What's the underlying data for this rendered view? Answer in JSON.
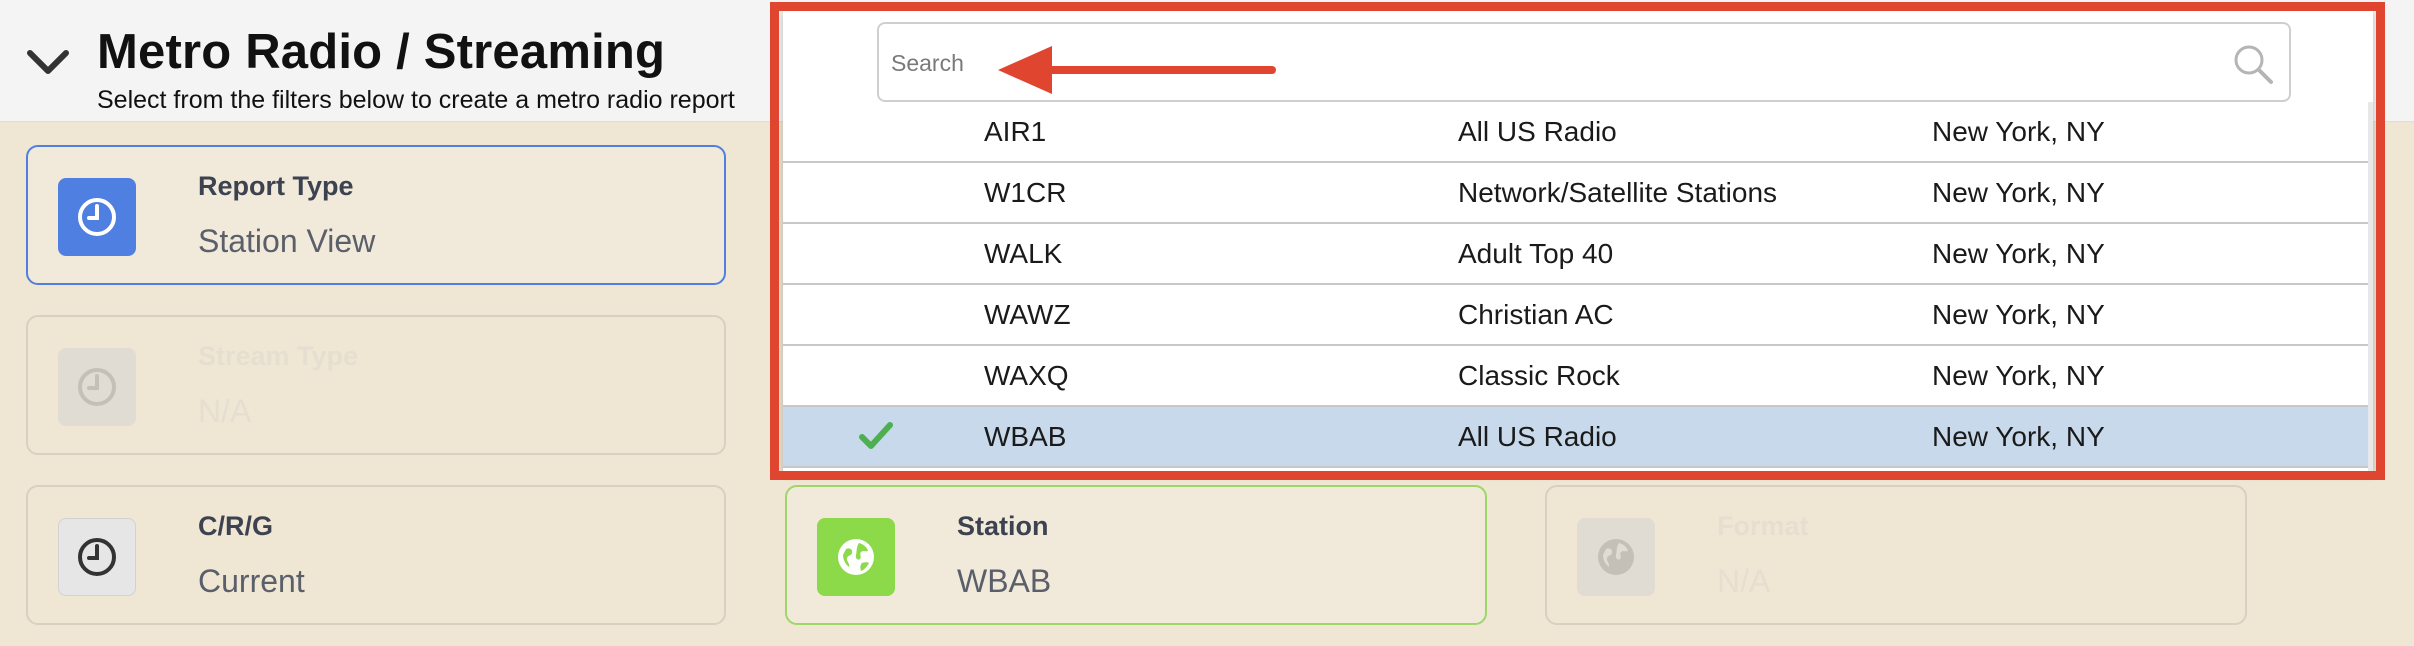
{
  "header": {
    "title": "Metro Radio / Streaming",
    "subtitle": "Select from the filters below to create a metro radio report"
  },
  "cards": {
    "report_type": {
      "label": "Report Type",
      "value": "Station View",
      "icon": "clock-icon",
      "state": "active"
    },
    "stream_type": {
      "label": "Stream Type",
      "value": "N/A",
      "icon": "clock-icon",
      "state": "disabled"
    },
    "crg": {
      "label": "C/R/G",
      "value": "Current",
      "icon": "clock-icon",
      "state": "enabled"
    },
    "station": {
      "label": "Station",
      "value": "WBAB",
      "icon": "globe-icon",
      "state": "active"
    },
    "format": {
      "label": "Format",
      "value": "N/A",
      "icon": "globe-icon",
      "state": "disabled"
    }
  },
  "dropdown": {
    "search_placeholder": "Search",
    "rows": [
      {
        "call": "AIR1",
        "format": "All US Radio",
        "market": "New York, NY",
        "selected": false
      },
      {
        "call": "W1CR",
        "format": "Network/Satellite Stations",
        "market": "New York, NY",
        "selected": false
      },
      {
        "call": "WALK",
        "format": "Adult Top 40",
        "market": "New York, NY",
        "selected": false
      },
      {
        "call": "WAWZ",
        "format": "Christian AC",
        "market": "New York, NY",
        "selected": false
      },
      {
        "call": "WAXQ",
        "format": "Classic Rock",
        "market": "New York, NY",
        "selected": false
      },
      {
        "call": "WBAB",
        "format": "All US Radio",
        "market": "New York, NY",
        "selected": true
      }
    ]
  },
  "colors": {
    "accent_blue": "#4f7fe0",
    "accent_green": "#8cd94a",
    "selected_row": "#c7d9ea",
    "annotation_red": "#e0452f",
    "check_green": "#4cb050"
  }
}
